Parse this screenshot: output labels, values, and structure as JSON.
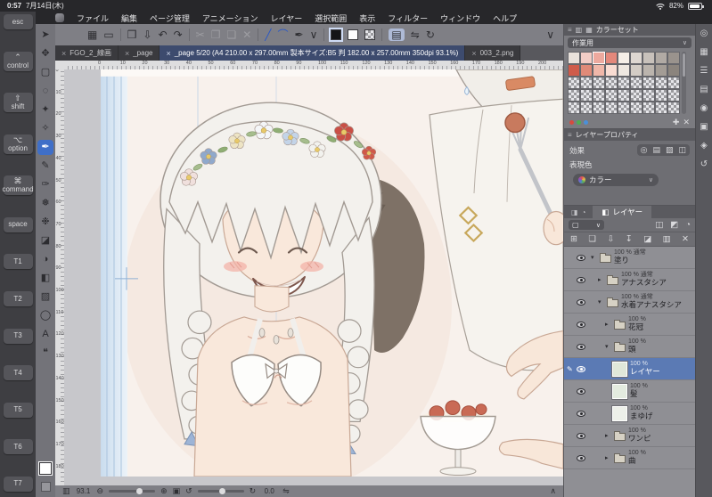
{
  "status_bar": {
    "time": "0:57",
    "date": "7月14日(木)",
    "battery_percent": "82%"
  },
  "menu_bar": {
    "items": [
      "ファイル",
      "編集",
      "ページ管理",
      "アニメーション",
      "レイヤー",
      "選択範囲",
      "表示",
      "フィルター",
      "ウィンドウ",
      "ヘルプ"
    ]
  },
  "modifier_keys": [
    {
      "label": "esc"
    },
    {
      "symbol": "⌃",
      "label": "control"
    },
    {
      "symbol": "⇧",
      "label": "shift"
    },
    {
      "symbol": "⌥",
      "label": "option"
    },
    {
      "symbol": "⌘",
      "label": "command"
    },
    {
      "label": "space"
    },
    {
      "label": "T1"
    },
    {
      "label": "T2"
    },
    {
      "label": "T3"
    },
    {
      "label": "T4"
    },
    {
      "label": "T5"
    },
    {
      "label": "T6"
    },
    {
      "label": "T7"
    }
  ],
  "tool_strip": {
    "tools": [
      {
        "name": "operate-tool",
        "glyph": "➤"
      },
      {
        "name": "move-layer-tool",
        "glyph": "✥"
      },
      {
        "name": "selection-tool",
        "glyph": "▢"
      },
      {
        "name": "lasso-tool",
        "glyph": "◌"
      },
      {
        "name": "auto-select-tool",
        "glyph": "✦"
      },
      {
        "name": "eyedropper-tool",
        "glyph": "✧"
      },
      {
        "name": "pen-tool",
        "glyph": "✒",
        "selected": true
      },
      {
        "name": "pencil-tool",
        "glyph": "✎"
      },
      {
        "name": "brush-tool",
        "glyph": "✑"
      },
      {
        "name": "airbrush-tool",
        "glyph": "❅"
      },
      {
        "name": "decoration-tool",
        "glyph": "❉"
      },
      {
        "name": "eraser-tool",
        "glyph": "◪"
      },
      {
        "name": "blend-tool",
        "glyph": "◑"
      },
      {
        "name": "fill-tool",
        "glyph": "◧"
      },
      {
        "name": "gradient-tool",
        "glyph": "▨"
      },
      {
        "name": "figure-tool",
        "glyph": "◯"
      },
      {
        "name": "text-tool",
        "glyph": "A"
      },
      {
        "name": "balloon-tool",
        "glyph": "❝"
      }
    ]
  },
  "toolbar": {
    "items": [
      {
        "name": "workspace-icon",
        "glyph": "▦"
      },
      {
        "name": "reference-icon",
        "glyph": "▭"
      },
      {
        "kind": "sep"
      },
      {
        "name": "open-icon",
        "glyph": "❒"
      },
      {
        "name": "save-icon",
        "glyph": "⇩"
      },
      {
        "name": "undo-icon",
        "glyph": "↶"
      },
      {
        "name": "redo-icon",
        "glyph": "↷"
      },
      {
        "kind": "sep"
      },
      {
        "name": "cut-icon",
        "glyph": "✂",
        "disabled": true
      },
      {
        "name": "copy-icon",
        "glyph": "❐",
        "disabled": true
      },
      {
        "name": "paste-icon",
        "glyph": "❏",
        "disabled": true
      },
      {
        "name": "delete-icon",
        "glyph": "✕",
        "disabled": true
      },
      {
        "kind": "sep"
      },
      {
        "name": "line-tool-icon",
        "glyph": "╱",
        "accent": true
      },
      {
        "name": "curve-tool-icon",
        "glyph": "⌒",
        "accent": true
      },
      {
        "name": "brush-tip-icon",
        "glyph": "✒"
      },
      {
        "name": "brush-dropdown-icon",
        "glyph": "∨"
      },
      {
        "kind": "sep"
      },
      {
        "kind": "swatch",
        "name": "main-color-swatch",
        "swatch": "black",
        "selected": true
      },
      {
        "kind": "swatch",
        "name": "sub-color-swatch",
        "swatch": "white"
      },
      {
        "kind": "swatch",
        "name": "transparent-color-swatch",
        "swatch": "checker"
      },
      {
        "kind": "sep"
      },
      {
        "name": "show-palette-icon",
        "glyph": "▤",
        "active": true
      },
      {
        "name": "flip-canvas-icon",
        "glyph": "⇋"
      },
      {
        "name": "rotate-canvas-icon",
        "glyph": "↻"
      },
      {
        "kind": "push"
      },
      {
        "name": "toolbar-collapse-icon",
        "glyph": "∨"
      }
    ]
  },
  "tab_bar": {
    "close_glyph": "×",
    "tabs": [
      {
        "label": "FGO_2_線画"
      },
      {
        "label": "_page"
      },
      {
        "label": "_page 5/20 (A4 210.00 x 297.00mm 製本サイズ:B5 判 182.00 x 257.00mm 350dpi 93.1%)",
        "active": true
      },
      {
        "label": "003_2.png"
      }
    ]
  },
  "rulers": {
    "top_labels": [
      "0",
      "10",
      "20",
      "30",
      "40",
      "50",
      "60",
      "70",
      "80",
      "90",
      "100",
      "110",
      "120",
      "130",
      "140",
      "150",
      "160",
      "170",
      "180",
      "190",
      "200"
    ],
    "left_labels": [
      "0",
      "10",
      "20",
      "30",
      "40",
      "50",
      "60",
      "70",
      "80",
      "90",
      "100",
      "110",
      "120",
      "130",
      "140",
      "150",
      "160",
      "170",
      "180"
    ]
  },
  "right_dock": {
    "icons": [
      {
        "name": "color-wheel-icon",
        "glyph": "◎"
      },
      {
        "name": "color-set-icon",
        "glyph": "▦"
      },
      {
        "name": "color-slider-icon",
        "glyph": "☰"
      },
      {
        "name": "approx-color-icon",
        "glyph": "▤"
      },
      {
        "name": "brush-size-icon",
        "glyph": "◉"
      },
      {
        "name": "material-icon",
        "glyph": "▣"
      },
      {
        "name": "navigator-icon",
        "glyph": "◈"
      },
      {
        "name": "history-icon",
        "glyph": "↺"
      }
    ]
  },
  "color_set_panel": {
    "title": "カラーセット",
    "tab_icons": [
      "▥",
      "▦"
    ],
    "preset": "作業用",
    "grid": {
      "columns": 9,
      "selected_cell": {
        "row": 0,
        "col": 2
      },
      "rows": [
        [
          "#e9e2dc",
          "#f3cdc6",
          "#eda99e",
          "#e4887b",
          "#f6efe8",
          "#ded7d1",
          "#c8c1bb",
          "#b1aaa4",
          "#9a938d"
        ],
        [
          "#cf5c4b",
          "#e08a78",
          "#f0b7a9",
          "#f9dcd2",
          "#efe8e1",
          "#d3ccc5",
          "#bbb4ad",
          "#a39c95",
          "#8b847d"
        ],
        [
          "T",
          "T",
          "T",
          "T",
          "T",
          "T",
          "T",
          "T",
          "T"
        ],
        [
          "T",
          "T",
          "T",
          "T",
          "T",
          "T",
          "T",
          "T",
          "T"
        ],
        [
          "T",
          "T",
          "T",
          "T",
          "T",
          "T",
          "T",
          "T",
          "T"
        ]
      ]
    },
    "footer_dots": [
      "#d64b3f",
      "#4caf50",
      "#4a90d8"
    ]
  },
  "layer_property_panel": {
    "title": "レイヤープロパティ",
    "effect_label": "効果",
    "effect_icons": [
      {
        "name": "border-effect-icon",
        "glyph": "◎"
      },
      {
        "name": "paper-texture-icon",
        "glyph": "▤"
      },
      {
        "name": "tone-effect-icon",
        "glyph": "▨"
      },
      {
        "name": "layer-color-effect-icon",
        "glyph": "◫"
      }
    ],
    "expression_label": "表現色",
    "expression_value": "カラー"
  },
  "layer_panel": {
    "tab_label": "レイヤー",
    "alt_tab_icons": [
      "◨",
      "◔"
    ],
    "active_tab_icon": "◧",
    "blend_glyph": "▢",
    "ctrl_icons": [
      {
        "name": "layer-mask-icon",
        "glyph": "◫"
      },
      {
        "name": "lock-layer-icon",
        "glyph": "◩"
      },
      {
        "name": "clip-layer-icon",
        "glyph": "◔"
      }
    ],
    "toolbar_icons": [
      {
        "name": "new-layer-icon",
        "glyph": "⊞"
      },
      {
        "name": "new-folder-icon",
        "glyph": "❏"
      },
      {
        "name": "transfer-layer-icon",
        "glyph": "⇩"
      },
      {
        "name": "merge-layer-icon",
        "glyph": "↧"
      },
      {
        "name": "create-mask-icon",
        "glyph": "◪"
      },
      {
        "name": "two-pane-icon",
        "glyph": "▥"
      },
      {
        "name": "delete-layer-icon",
        "glyph": "✕"
      }
    ],
    "layers": [
      {
        "indent": 0,
        "kind": "folder",
        "expanded": true,
        "line1": "100 % 通常",
        "name": "塗り",
        "eye": true
      },
      {
        "indent": 1,
        "kind": "folder",
        "expanded": false,
        "line1": "100 % 通常",
        "name": "アナスタシア",
        "eye": true
      },
      {
        "indent": 1,
        "kind": "folder",
        "expanded": true,
        "line1": "100 % 通常",
        "name": "水着アナスタシア",
        "eye": true
      },
      {
        "indent": 2,
        "kind": "folder",
        "expanded": false,
        "line1": "100 %",
        "name": "花冠",
        "eye": true
      },
      {
        "indent": 2,
        "kind": "folder",
        "expanded": true,
        "line1": "100 %",
        "name": "頭",
        "eye": true
      },
      {
        "indent": 3,
        "kind": "layer",
        "selected": true,
        "editing": true,
        "thumb": "#dfe7d9",
        "line1": "100 %",
        "name": "レイヤー",
        "eye": true
      },
      {
        "indent": 3,
        "kind": "layer",
        "thumb": "#e3ebdf",
        "line1": "100 %",
        "name": "髪",
        "eye": true
      },
      {
        "indent": 3,
        "kind": "layer",
        "thumb": "#edf0e9",
        "line1": "100 %",
        "name": "まゆげ",
        "eye": true
      },
      {
        "indent": 2,
        "kind": "folder",
        "expanded": false,
        "line1": "100 %",
        "name": "ワンピ",
        "eye": true
      },
      {
        "indent": 2,
        "kind": "folder",
        "expanded": false,
        "line1": "100 %",
        "name": "曲",
        "eye": true
      }
    ]
  },
  "bottom_bar": {
    "zoom_value": "93.1",
    "rotation_value": "0.0",
    "icons": {
      "hide_palette": "▥",
      "zoom_out": "⊖",
      "zoom_in": "⊕",
      "fit": "▣",
      "rotate_left": "↺",
      "rotate_right": "↻",
      "flip": "⇋",
      "collapse": "∧"
    }
  },
  "icons": {
    "pencil": "✎",
    "grip": "≡",
    "chevron_down": "∨",
    "plus": "✚",
    "trash": "✕",
    "arrow_collapsed": "▸",
    "arrow_expanded": "▾"
  }
}
